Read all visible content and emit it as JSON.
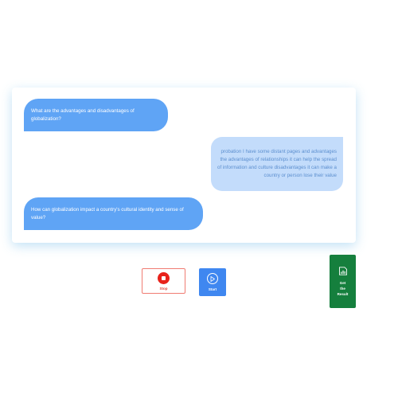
{
  "chat": {
    "messages": [
      {
        "role": "question",
        "text": "What are the advantages and disadvantages of globalization?"
      },
      {
        "role": "answer",
        "text": "probation I have some distant pages and advantages the advantages of relationships it can help the spread of information and culture disadvantages it can make a country or person lose their value"
      },
      {
        "role": "question",
        "text": "How can globalization impact a country's cultural identity and sense of value?"
      }
    ]
  },
  "controls": {
    "stop_label": "Stop",
    "start_label": "Start",
    "result_label_lines": [
      "Get",
      "the",
      "Result"
    ]
  },
  "colors": {
    "question_bubble": "#5fa4f5",
    "answer_bubble": "#c3dcfb",
    "stop_accent": "#e8221b",
    "start_button": "#3f87f0",
    "result_button": "#157f3d"
  },
  "icons": {
    "stop": "stop-icon",
    "start": "play-icon",
    "result": "chart-icon"
  }
}
